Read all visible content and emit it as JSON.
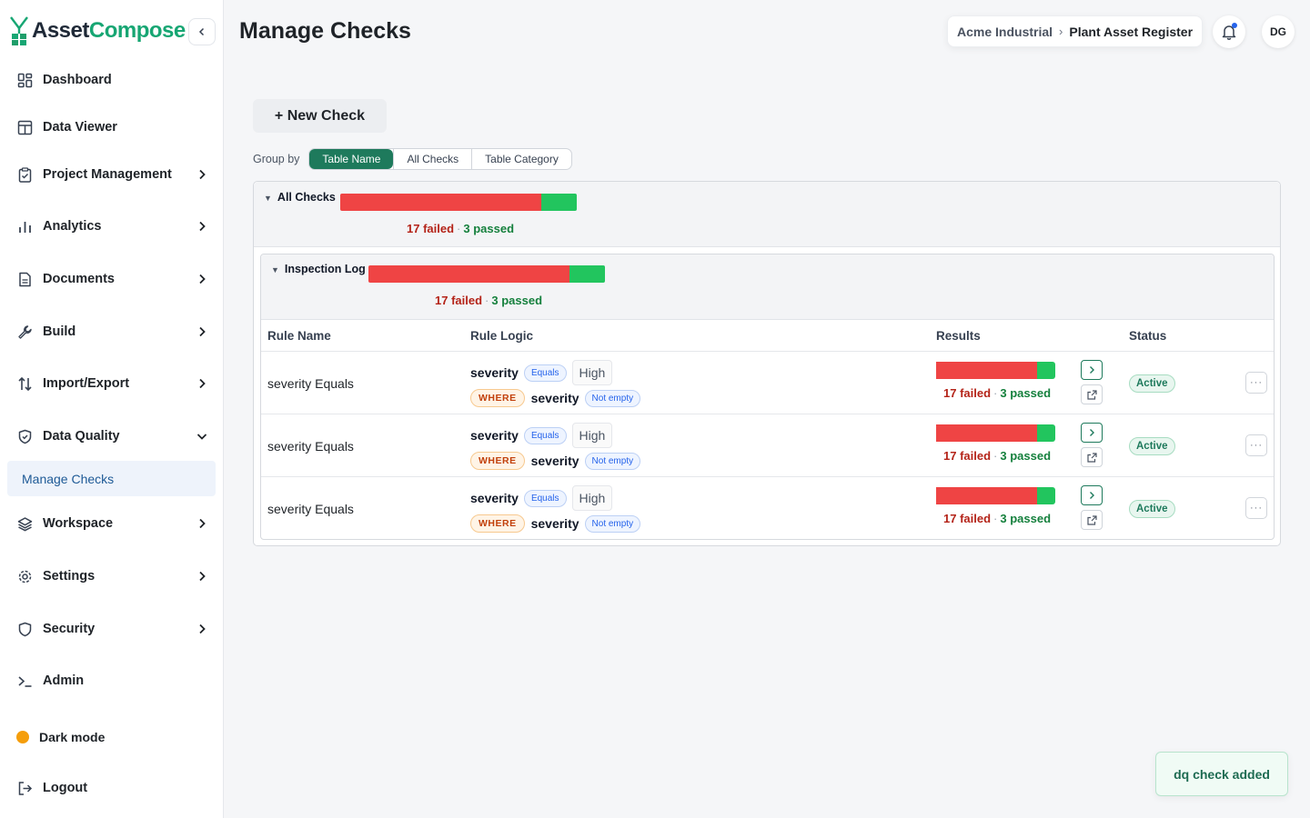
{
  "app": {
    "logo_part1": "Asset",
    "logo_part2": "Compose",
    "brand_color": "#17a673"
  },
  "sidebar": {
    "items": [
      {
        "label": "Dashboard",
        "icon": "dashboard-icon",
        "has_chevron": false
      },
      {
        "label": "Data Viewer",
        "icon": "table-icon",
        "has_chevron": false
      },
      {
        "label": "Project Management",
        "icon": "clipboard-icon",
        "has_chevron": true
      },
      {
        "label": "Analytics",
        "icon": "bar-chart-icon",
        "has_chevron": true
      },
      {
        "label": "Documents",
        "icon": "document-icon",
        "has_chevron": true
      },
      {
        "label": "Build",
        "icon": "wrench-icon",
        "has_chevron": true
      },
      {
        "label": "Import/Export",
        "icon": "arrows-up-down-icon",
        "has_chevron": true
      },
      {
        "label": "Data Quality",
        "icon": "shield-check-icon",
        "has_chevron": true,
        "expanded": true
      },
      {
        "label": "Workspace",
        "icon": "layers-icon",
        "has_chevron": true
      },
      {
        "label": "Settings",
        "icon": "gear-icon",
        "has_chevron": true
      },
      {
        "label": "Security",
        "icon": "shield-icon",
        "has_chevron": true
      },
      {
        "label": "Admin",
        "icon": "terminal-icon",
        "has_chevron": false
      }
    ],
    "sub_item": "Manage Checks",
    "dark_mode_label": "Dark mode",
    "logout_label": "Logout"
  },
  "header": {
    "title": "Manage Checks",
    "breadcrumb_org": "Acme Industrial",
    "breadcrumb_sep": "›",
    "breadcrumb_project": "Plant Asset Register",
    "avatar_initials": "DG"
  },
  "toolbar": {
    "new_check_label": "+ New Check",
    "group_by_label": "Group by",
    "group_options": [
      "Table Name",
      "All Checks",
      "Table Category"
    ],
    "group_selected": "Table Name"
  },
  "groups": {
    "outer": {
      "title": "All Checks",
      "failed": 17,
      "passed": 3,
      "failed_text": "17 failed",
      "passed_text": "3 passed",
      "sep": "·"
    },
    "inner": {
      "title": "Inspection Log",
      "failed": 17,
      "passed": 3,
      "failed_text": "17 failed",
      "passed_text": "3 passed",
      "sep": "·"
    }
  },
  "table": {
    "headers": {
      "rule_name": "Rule Name",
      "rule_logic": "Rule Logic",
      "results": "Results",
      "status": "Status"
    },
    "rows": [
      {
        "name": "severity Equals",
        "field": "severity",
        "operator": "Equals",
        "value": "High",
        "where": "WHERE",
        "where_field": "severity",
        "where_op": "Not empty",
        "failed": 17,
        "passed": 3,
        "failed_text": "17 failed",
        "passed_text": "3 passed",
        "sep": "·",
        "status": "Active"
      },
      {
        "name": "severity Equals",
        "field": "severity",
        "operator": "Equals",
        "value": "High",
        "where": "WHERE",
        "where_field": "severity",
        "where_op": "Not empty",
        "failed": 17,
        "passed": 3,
        "failed_text": "17 failed",
        "passed_text": "3 passed",
        "sep": "·",
        "status": "Active"
      },
      {
        "name": "severity Equals",
        "field": "severity",
        "operator": "Equals",
        "value": "High",
        "where": "WHERE",
        "where_field": "severity",
        "where_op": "Not empty",
        "failed": 17,
        "passed": 3,
        "failed_text": "17 failed",
        "passed_text": "3 passed",
        "sep": "·",
        "status": "Active"
      }
    ],
    "more_label": "···"
  },
  "toast": {
    "message": "dq check added"
  },
  "colors": {
    "failed": "#ef4444",
    "passed": "#22c55e",
    "accent": "#1e7a5c"
  }
}
